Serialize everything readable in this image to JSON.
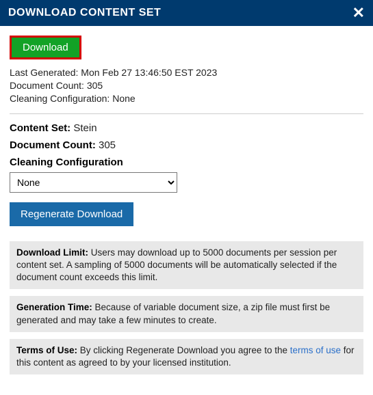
{
  "header": {
    "title": "DOWNLOAD CONTENT SET",
    "close": "✕"
  },
  "download_button": "Download",
  "meta": {
    "last_generated_label": "Last Generated: ",
    "last_generated_value": "Mon Feb 27 13:46:50 EST 2023",
    "doc_count_label": "Document Count: ",
    "doc_count_value": "305",
    "cleaning_label": "Cleaning Configuration: ",
    "cleaning_value": "None"
  },
  "fields": {
    "content_set_label": "Content Set:",
    "content_set_value": "Stein",
    "doc_count_label": "Document Count:",
    "doc_count_value": "305",
    "cleaning_config_label": "Cleaning Configuration",
    "cleaning_config_selected": "None"
  },
  "regenerate_button": "Regenerate Download",
  "notes": {
    "download_limit_title": "Download Limit:",
    "download_limit_text": " Users may download up to 5000 documents per session per content set. A sampling of 5000 documents will be automatically selected if the document count exceeds this limit.",
    "generation_time_title": "Generation Time:",
    "generation_time_text": " Because of variable document size, a zip file must first be generated and may take a few minutes to create.",
    "terms_title": "Terms of Use:",
    "terms_text_1": " By clicking Regenerate Download you agree to the ",
    "terms_link": "terms of use",
    "terms_text_2": " for this content as agreed to by your licensed institution."
  }
}
